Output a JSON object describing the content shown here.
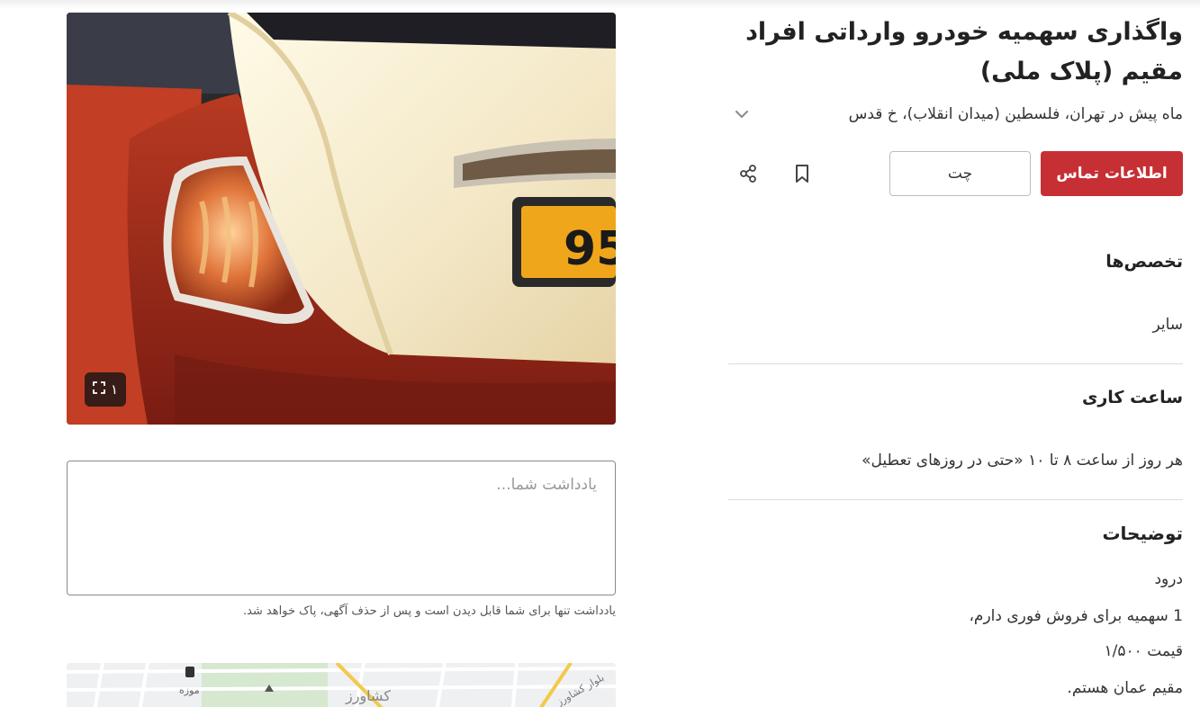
{
  "listing": {
    "title": "واگذاری سهمیه خودرو وارداتی افراد مقیم (پلاک ملی)",
    "meta": "ماه پیش در تهران، فلسطین (میدان انقلاب)، خ قدس"
  },
  "actions": {
    "contact_label": "اطلاعات تماس",
    "chat_label": "چت",
    "bookmark_icon": "bookmark-icon",
    "share_icon": "share-icon"
  },
  "specialties": {
    "title": "تخصص‌ها",
    "value": "سایر"
  },
  "hours": {
    "title": "ساعت کاری",
    "value": "هر روز از ساعت ۸ تا ۱۰ «حتی در روزهای تعطیل»"
  },
  "description": {
    "title": "توضیحات",
    "lines": [
      "درود",
      "1 سهمیه برای فروش فوری دارم،",
      "قیمت ۱/۵۰۰",
      "مقیم عمان هستم."
    ]
  },
  "gallery": {
    "count": "۱",
    "plate_text": "95",
    "expand_icon": "expand-icon"
  },
  "note": {
    "placeholder": "یادداشت شما...",
    "hint": "یادداشت تنها برای شما قابل دیدن است و پس از حذف آگهی، پاک خواهد شد."
  },
  "map": {
    "label_1": "کشاورز",
    "label_2": "موزه",
    "label_3": "بلوار کشاورز"
  },
  "colors": {
    "accent": "#c62f34",
    "text": "#222222",
    "divider": "#dcdcdc"
  }
}
